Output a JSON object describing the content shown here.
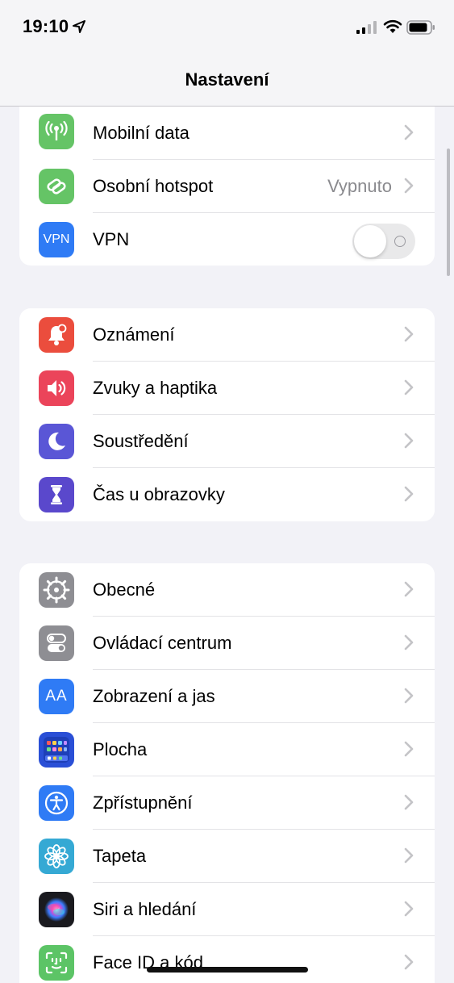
{
  "status": {
    "time": "19:10",
    "signal_icon": "cellular-signal-icon",
    "wifi_icon": "wifi-icon",
    "battery_icon": "battery-icon"
  },
  "nav": {
    "title": "Nastavení"
  },
  "colors": {
    "background": "#f2f2f7",
    "chevron": "#c4c4c7",
    "value": "#8a8a8e"
  },
  "groups": [
    {
      "rows": [
        {
          "label": "Mobilní data",
          "icon": "antenna-icon",
          "color": "#65c466"
        },
        {
          "label": "Osobní hotspot",
          "value": "Vypnuto",
          "icon": "hotspot-link-icon",
          "color": "#65c466"
        },
        {
          "label": "VPN",
          "icon": "vpn-icon",
          "icon_text": "VPN",
          "color": "#2f7bf5",
          "toggle": false
        }
      ]
    },
    {
      "rows": [
        {
          "label": "Oznámení",
          "icon": "bell-icon",
          "color": "#eb4d3d"
        },
        {
          "label": "Zvuky a haptika",
          "icon": "speaker-icon",
          "color": "#eb445a"
        },
        {
          "label": "Soustředění",
          "icon": "moon-icon",
          "color": "#5a56d6"
        },
        {
          "label": "Čas u obrazovky",
          "icon": "hourglass-icon",
          "color": "#5a48cc"
        }
      ]
    },
    {
      "rows": [
        {
          "label": "Obecné",
          "icon": "gear-icon",
          "color": "#8e8e93"
        },
        {
          "label": "Ovládací centrum",
          "icon": "switches-icon",
          "color": "#8e8e93"
        },
        {
          "label": "Zobrazení a jas",
          "icon": "text-size-icon",
          "icon_text": "AA",
          "color": "#2f7bf5"
        },
        {
          "label": "Plocha",
          "icon": "home-screen-icon",
          "color": "#2a4fd6"
        },
        {
          "label": "Zpřístupnění",
          "icon": "accessibility-icon",
          "color": "#2f7bf5"
        },
        {
          "label": "Tapeta",
          "icon": "flower-icon",
          "color": "#35a9d4"
        },
        {
          "label": "Siri a hledání",
          "icon": "siri-icon",
          "color": "#222"
        },
        {
          "label": "Face ID a kód",
          "icon": "face-id-icon",
          "color": "#5cc466"
        }
      ]
    }
  ]
}
